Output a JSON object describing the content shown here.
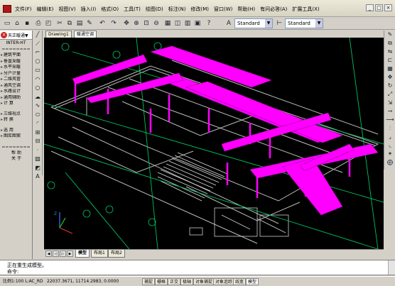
{
  "menu": [
    "文件(F)",
    "编辑(E)",
    "视图(V)",
    "插入(I)",
    "格式(O)",
    "工具(T)",
    "绘图(D)",
    "标注(N)",
    "修改(M)",
    "窗口(W)",
    "帮助(H)",
    "有问必答(A)",
    "扩展工具(X)"
  ],
  "window_controls": [
    "_",
    "□",
    "×"
  ],
  "toolbar": {
    "text_style": "Standard",
    "dim_style": "Standard"
  },
  "left_panel": {
    "title": "天正暖通▼",
    "brand": "INTER-HT",
    "separator": "========",
    "items_a": [
      "建筑平面",
      "垂直采暖",
      "水平采暖",
      "分户计量",
      "二维风管",
      "通风空调",
      "水路设计",
      "通用辅助",
      "计    算"
    ],
    "items_b": [
      "三维视点",
      "转    换"
    ],
    "items_c": [
      "选    用",
      "图库图案"
    ],
    "footer": [
      "帮    助",
      "关    于"
    ]
  },
  "doc_tabs": [
    "Drawing1",
    "暖通空调"
  ],
  "layout_tabs": [
    "模型",
    "布局1",
    "布局2"
  ],
  "command": {
    "line1": "正在重生成模型。",
    "line2": "命令:"
  },
  "status": {
    "scale": "比例1:100 L:AC_RD",
    "coords": "22037.3671, 11714.2983, 0.0000",
    "buttons": [
      "捕捉",
      "栅格",
      "正交",
      "极轴",
      "对象捕捉",
      "对象追踪",
      "线宽",
      "模型"
    ]
  },
  "colors": {
    "duct": "#ff00ff",
    "axis": "#00c060",
    "wall": "#c8c8c8",
    "canvas": "#000000"
  },
  "icons": [
    "save-icon",
    "undo-icon",
    "redo-icon",
    "pan-icon",
    "zoom-icon",
    "line-icon",
    "circle-icon",
    "arc-icon",
    "move-icon",
    "copy-icon"
  ]
}
